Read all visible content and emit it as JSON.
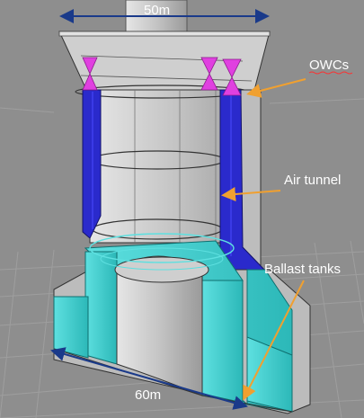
{
  "labels": {
    "top_dimension": "50m",
    "bottom_dimension": "60m",
    "owcs": "OWCs",
    "air_tunnel": "Air tunnel",
    "ballast_tanks": "Ballast tanks"
  },
  "colors": {
    "background": "#8e8e8e",
    "grid": "#a3a3a3",
    "structure": "#d8d8d8",
    "air_tunnel": "#2a2acc",
    "ballast": "#3fd0d0",
    "owc_marker": "#e040e0",
    "callout_arrow": "#f0a030",
    "dimension_arrow": "#1a3a8a"
  }
}
